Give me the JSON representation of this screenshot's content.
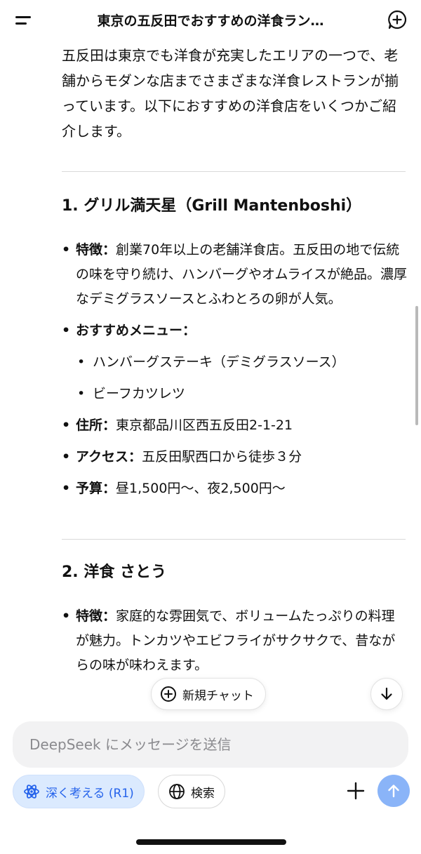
{
  "header": {
    "title": "東京の五反田でおすすめの洋食ラン…",
    "menu_icon": "menu-icon",
    "new_chat_icon": "new-chat-icon"
  },
  "content": {
    "intro": "五反田は東京でも洋食が充実したエリアの一つで、老舗からモダンな店までさまざまな洋食レストランが揃っています。以下におすすめの洋食店をいくつかご紹介します。",
    "sections": [
      {
        "title": "1. グリル満天星（Grill Mantenboshi）",
        "feature_label": "特徴：",
        "feature_text": "創業70年以上の老舗洋食店。五反田の地で伝統の味を守り続け、ハンバーグやオムライスが絶品。濃厚なデミグラスソースとふわとろの卵が人気。",
        "menu_label": "おすすめメニュー：",
        "menu_items": [
          "ハンバーグステーキ（デミグラスソース）",
          "ビーフカツレツ"
        ],
        "address_label": "住所：",
        "address_text": "東京都品川区西五反田2-1-21",
        "access_label": "アクセス：",
        "access_text": "五反田駅西口から徒歩３分",
        "budget_label": "予算：",
        "budget_text": "昼1,500円〜、夜2,500円〜"
      },
      {
        "title": "2. 洋食 さとう",
        "feature_label": "特徴：",
        "feature_text": "家庭的な雰囲気で、ボリュームたっぷりの料理が魅力。トンカツやエビフライがサクサクで、昔ながらの味が味わえます。"
      }
    ]
  },
  "overlay": {
    "new_chat_label": "新規チャット",
    "scroll_down_icon": "arrow-down-icon"
  },
  "composer": {
    "placeholder": "DeepSeek にメッセージを送信"
  },
  "toolbar": {
    "deep_think_label": "深く考える (R1)",
    "search_label": "検索",
    "accent_color": "#2563eb",
    "send_color": "#8ab4f8"
  }
}
